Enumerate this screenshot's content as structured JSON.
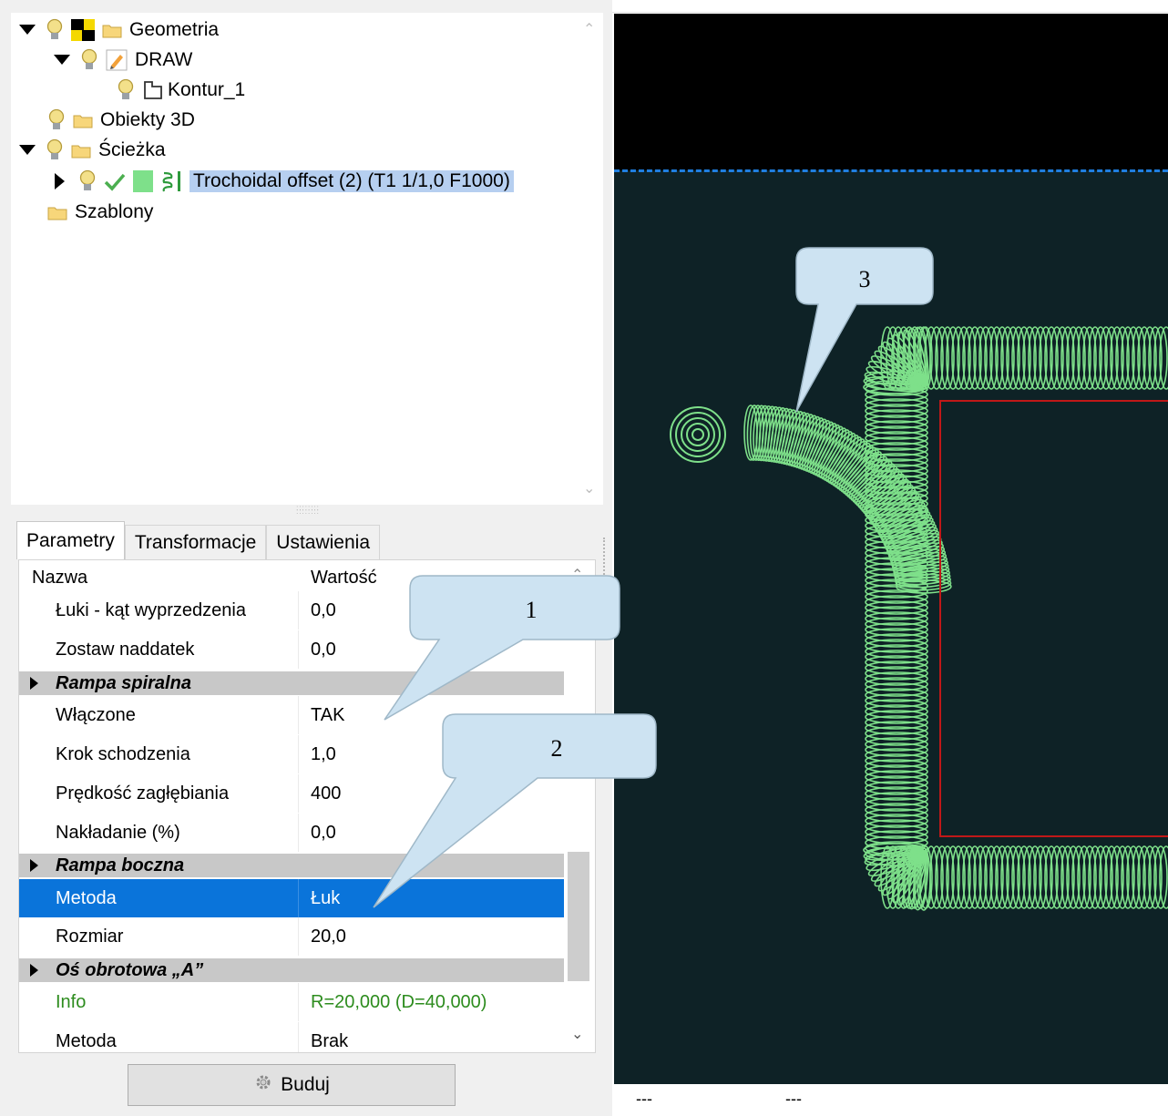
{
  "tree": {
    "items": [
      {
        "label": "Geometria",
        "level": 0,
        "expanded": true
      },
      {
        "label": "DRAW",
        "level": 1,
        "expanded": true
      },
      {
        "label": "Kontur_1",
        "level": 2
      },
      {
        "label": "Obiekty 3D",
        "level": 0
      },
      {
        "label": "Ścieżka",
        "level": 0,
        "expanded": true
      },
      {
        "label": "Trochoidal offset (2) (T1 1/1,0 F1000)",
        "level": 1,
        "selected": true
      },
      {
        "label": "Szablony",
        "level": 0
      }
    ]
  },
  "tabs": [
    {
      "label": "Parametry",
      "active": true
    },
    {
      "label": "Transformacje",
      "active": false
    },
    {
      "label": "Ustawienia",
      "active": false
    }
  ],
  "properties": {
    "header": {
      "name": "Nazwa",
      "value": "Wartość"
    },
    "rows": [
      {
        "type": "prop",
        "name": "Łuki - kąt wyprzedzenia",
        "value": "0,0"
      },
      {
        "type": "prop",
        "name": "Zostaw naddatek",
        "value": "0,0"
      },
      {
        "type": "group",
        "name": "Rampa spiralna"
      },
      {
        "type": "prop",
        "name": "Włączone",
        "value": "TAK"
      },
      {
        "type": "prop",
        "name": "Krok schodzenia",
        "value": "1,0"
      },
      {
        "type": "prop",
        "name": "Prędkość zagłębiania",
        "value": "400"
      },
      {
        "type": "prop",
        "name": "Nakładanie (%)",
        "value": "0,0"
      },
      {
        "type": "group",
        "name": "Rampa boczna"
      },
      {
        "type": "prop",
        "name": "Metoda",
        "value": "Łuk",
        "selected": true
      },
      {
        "type": "prop",
        "name": "Rozmiar",
        "value": "20,0"
      },
      {
        "type": "group",
        "name": "Oś obrotowa „A”"
      },
      {
        "type": "info",
        "name": "Info",
        "value": "R=20,000 (D=40,000)"
      },
      {
        "type": "prop",
        "name": "Metoda",
        "value": "Brak"
      }
    ]
  },
  "build_button": {
    "label": "Buduj"
  },
  "status": {
    "left": "---",
    "right": "---"
  },
  "callouts": {
    "c1": "1",
    "c2": "2",
    "c3": "3"
  },
  "colors": {
    "toolpath": "#7ee08a",
    "contour": "#c01818",
    "viewport_bg": "#0e2226",
    "selection": "#0a74da",
    "dashed_line": "#1f7fe0"
  }
}
